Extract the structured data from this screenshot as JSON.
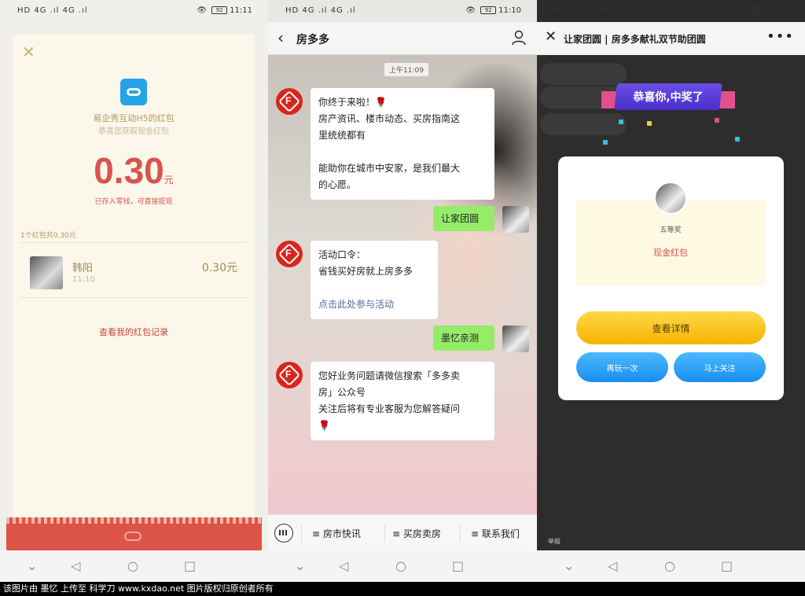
{
  "status": {
    "left": "HD 4G .ıl 4G .ıl",
    "p1_right": "11:11",
    "p2_right": "11:10",
    "p3_right": "11:10",
    "battery": "92"
  },
  "panel1": {
    "close_icon": "close-icon",
    "sender_line": "易企秀互动H5的红包",
    "sub_line": "恭喜您获取现金红包",
    "amount": "0.30",
    "unit": "元",
    "note": "已存入零钱，可直接提现",
    "count_line": "1个红包共0.30元",
    "record": {
      "name": "韩阳",
      "time": "11:10",
      "value": "0.30元"
    },
    "view_link": "查看我的红包记录"
  },
  "panel2": {
    "title": "房多多",
    "time_chip": "上午11:09",
    "msg1": [
      "你终于来啦！🌹",
      "房产资讯、楼市动态、买房指南这",
      "里统统都有",
      "",
      "能助你在城市中安家，是我们最大",
      "的心愿。"
    ],
    "me1": "让家团圆",
    "msg2": [
      "活动口令：",
      "省钱买好房就上房多多"
    ],
    "msg2_link": "点击此处参与活动",
    "me2": "墨忆亲测",
    "msg3": [
      "您好业务问题请微信搜索「多多卖",
      "房」公众号",
      "关注后将有专业客服为您解答疑问",
      "🌹"
    ],
    "menu": [
      "≡ 房市快讯",
      "≡ 买房卖房",
      "≡ 联系我们"
    ]
  },
  "panel3": {
    "title": "让家团圆 | 房多多献礼双节助团圆",
    "more": "•••",
    "ribbon": "恭喜你,中奖了",
    "level": "五等奖",
    "prize": "现金红包",
    "btn_detail": "查看详情",
    "btn_again": "再玩一次",
    "btn_follow": "马上关注",
    "footer": "举报"
  },
  "nav": {
    "back": "◁",
    "home": "○",
    "recent": "□",
    "down": "⌄"
  },
  "watermark": "该图片由 墨忆 上传至 科学刀 www.kxdao.net 图片版权归原创者所有",
  "colors": {
    "wechat_green": "#95ec69",
    "red": "#d9534f",
    "blue": "#1a8ef0",
    "gold": "#f5b400"
  }
}
